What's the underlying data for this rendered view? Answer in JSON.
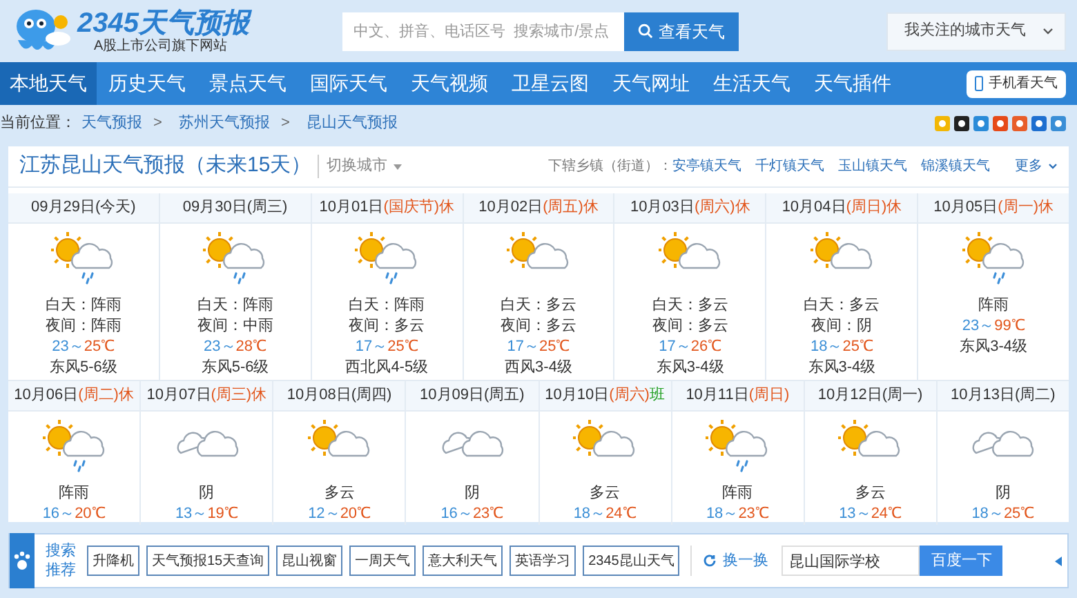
{
  "logo": {
    "brand": "2345天气预报",
    "tagline": "A股上市公司旗下网站"
  },
  "search": {
    "placeholder": "中文、拼音、电话区号  搜索城市/景点",
    "button": "查看天气"
  },
  "favorites": {
    "label": "我关注的城市天气"
  },
  "nav": {
    "items": [
      {
        "label": "本地天气",
        "selected": true
      },
      {
        "label": "历史天气",
        "selected": false
      },
      {
        "label": "景点天气",
        "selected": false
      },
      {
        "label": "国际天气",
        "selected": false
      },
      {
        "label": "天气视频",
        "selected": false
      },
      {
        "label": "卫星云图",
        "selected": false
      },
      {
        "label": "天气网址",
        "selected": false
      },
      {
        "label": "生活天气",
        "selected": false
      },
      {
        "label": "天气插件",
        "selected": false
      }
    ],
    "mobile_button": "手机看天气"
  },
  "breadcrumb": {
    "label": "当前位置：",
    "items": [
      "天气预报",
      "苏州天气预报",
      "昆山天气预报"
    ],
    "separator": ">"
  },
  "forecast": {
    "title": "江苏昆山天气预报（未来15天）",
    "switch_city": "切换城市",
    "towns_label": "下辖乡镇（街道）：",
    "towns": [
      "安亭镇天气",
      "千灯镇天气",
      "玉山镇天气",
      "锦溪镇天气"
    ],
    "more": "更多",
    "first_week": [
      {
        "kind": "sun-cloud-rain",
        "date": "09月29日",
        "week": "(今天)",
        "holiday": false,
        "day": "白天：阵雨",
        "night": "夜间：阵雨",
        "low": "23～",
        "high": "25℃",
        "wind": "东风5-6级"
      },
      {
        "kind": "sun-cloud-rain",
        "date": "09月30日",
        "week": "(周三)",
        "holiday": false,
        "day": "白天：阵雨",
        "night": "夜间：中雨",
        "low": "23～",
        "high": "28℃",
        "wind": "东风5-6级"
      },
      {
        "kind": "sun-cloud-rain",
        "date": "10月01日",
        "week": "(国庆节)",
        "holiday": true,
        "badge": {
          "text": "休",
          "color": "#e2561c"
        },
        "day": "白天：阵雨",
        "night": "夜间：多云",
        "low": "17～",
        "high": "25℃",
        "wind": "西北风4-5级"
      },
      {
        "kind": "sun-cloud",
        "date": "10月02日",
        "week": "(周五)",
        "holiday": true,
        "badge": {
          "text": "休",
          "color": "#e2561c"
        },
        "day": "白天：多云",
        "night": "夜间：多云",
        "low": "17～",
        "high": "25℃",
        "wind": "西风3-4级"
      },
      {
        "kind": "sun-cloud",
        "date": "10月03日",
        "week": "(周六)",
        "holiday": true,
        "badge": {
          "text": "休",
          "color": "#e2561c"
        },
        "day": "白天：多云",
        "night": "夜间：多云",
        "low": "17～",
        "high": "26℃",
        "wind": "东风3-4级"
      },
      {
        "kind": "sun-cloud",
        "date": "10月04日",
        "week": "(周日)",
        "holiday": true,
        "badge": {
          "text": "休",
          "color": "#e2561c"
        },
        "day": "白天：多云",
        "night": "夜间：阴",
        "low": "18～",
        "high": "25℃",
        "wind": "东风3-4级"
      },
      {
        "kind": "sun-cloud-rain",
        "date": "10月05日",
        "week": "(周一)",
        "holiday": true,
        "badge": {
          "text": "休",
          "color": "#e2561c"
        },
        "weather": "阵雨",
        "low": "23～",
        "high": "99℃",
        "wind": "东风3-4级"
      }
    ],
    "second_week": [
      {
        "kind": "sun-cloud-rain",
        "date": "10月06日",
        "week": "(周二)",
        "holiday": true,
        "badge": {
          "text": "休",
          "color": "#e2561c"
        },
        "weather": "阵雨",
        "low": "16～",
        "high": "20℃"
      },
      {
        "kind": "cloud",
        "date": "10月07日",
        "week": "(周三)",
        "holiday": true,
        "badge": {
          "text": "休",
          "color": "#e2561c"
        },
        "weather": "阴",
        "low": "13～",
        "high": "19℃"
      },
      {
        "kind": "sun-cloud",
        "date": "10月08日",
        "week": "(周四)",
        "holiday": false,
        "weather": "多云",
        "low": "12～",
        "high": "20℃"
      },
      {
        "kind": "cloud",
        "date": "10月09日",
        "week": "(周五)",
        "holiday": false,
        "weather": "阴",
        "low": "16～",
        "high": "23℃"
      },
      {
        "kind": "sun-cloud",
        "date": "10月10日",
        "week": "(周六)",
        "holiday": true,
        "badge": {
          "text": "班",
          "color": "#23a023"
        },
        "weather": "多云",
        "low": "18～",
        "high": "24℃"
      },
      {
        "kind": "sun-cloud-rain",
        "date": "10月11日",
        "week": "(周日)",
        "holiday": true,
        "weather": "阵雨",
        "low": "18～",
        "high": "23℃"
      },
      {
        "kind": "sun-cloud",
        "date": "10月12日",
        "week": "(周一)",
        "holiday": false,
        "weather": "多云",
        "low": "13～",
        "high": "24℃"
      },
      {
        "kind": "cloud",
        "date": "10月13日",
        "week": "(周二)",
        "holiday": false,
        "weather": "阴",
        "low": "18～",
        "high": "25℃"
      }
    ]
  },
  "bottom_bar": {
    "label": "搜索推荐",
    "tags": [
      "升降机",
      "天气预报15天查询",
      "昆山视窗",
      "一周天气",
      "意大利天气",
      "英语学习",
      "2345昆山天气"
    ],
    "refresh": "换一换",
    "query": "昆山国际学校",
    "button": "百度一下"
  }
}
